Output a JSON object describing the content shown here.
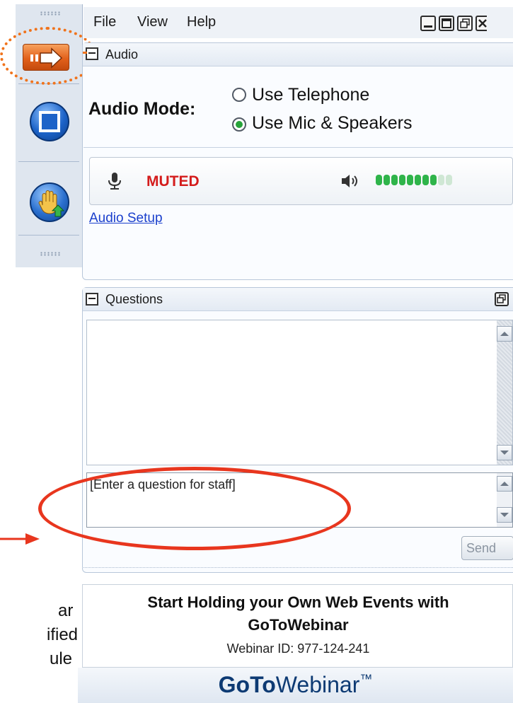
{
  "menu": {
    "file": "File",
    "view": "View",
    "help": "Help"
  },
  "audio": {
    "title": "Audio",
    "mode_label": "Audio Mode:",
    "options": [
      "Use Telephone",
      "Use Mic & Speakers"
    ],
    "selected": 1,
    "mic_status": "MUTED",
    "speaker_level_on": 8,
    "speaker_level_total": 10,
    "setup_link": "Audio Setup"
  },
  "questions": {
    "title": "Questions",
    "input_placeholder": "[Enter a question for staff]",
    "send_label": "Send"
  },
  "promo": {
    "line1": "Start Holding your Own Web Events with",
    "line2": "GoToWebinar",
    "webinar_id": "Webinar ID: 977-124-241"
  },
  "brand": {
    "bold": "GoTo",
    "regular": "Webinar",
    "tm": "™"
  },
  "side_note": [
    "ar",
    "ified",
    "ule"
  ],
  "colors": {
    "accent_orange": "#f0731c",
    "annotation_red": "#e8361e",
    "muted_red": "#d41c1c",
    "led_green": "#2fb44a"
  },
  "icons": {
    "show_hide": "arrow-right-icon",
    "screen": "screen-share-icon",
    "hand": "raise-hand-icon",
    "mic": "microphone-icon",
    "speaker": "speaker-icon"
  }
}
